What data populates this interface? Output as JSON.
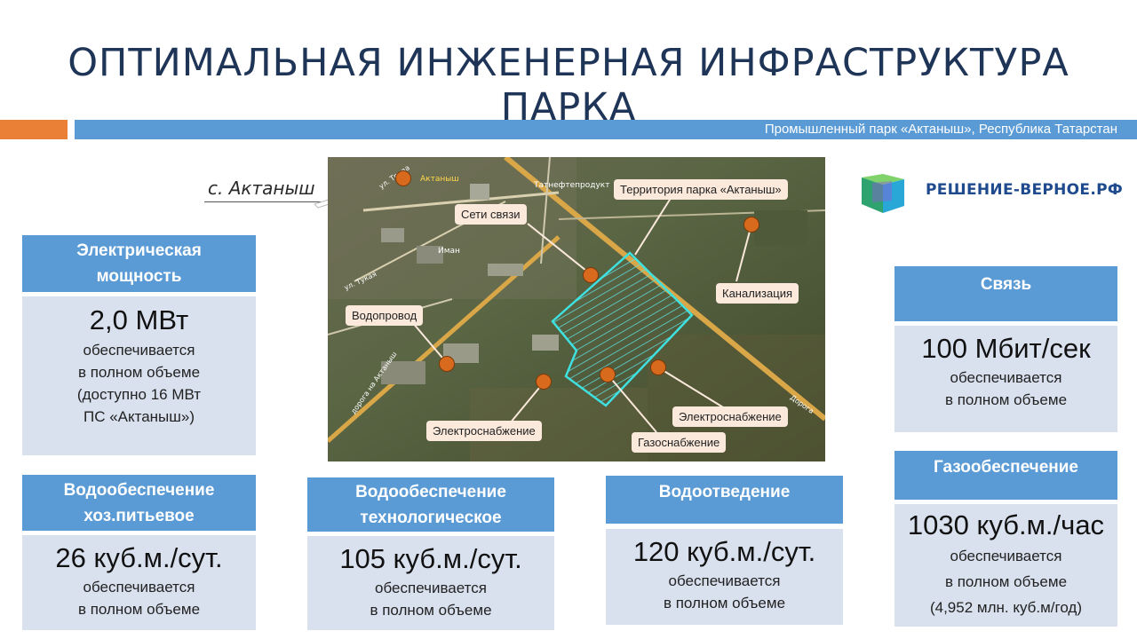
{
  "title": "ОПТИМАЛЬНАЯ ИНЖЕНЕРНАЯ ИНФРАСТРУКТУРА ПАРКА",
  "subtitle": "Промышленный парк «Актаныш», Республика Татарстан",
  "village_label": "с. Актаныш",
  "colors": {
    "accent_blue": "#5b9bd5",
    "accent_orange": "#ea7f36",
    "card_body": "#d9e1ef",
    "title": "#1f3558"
  },
  "logo": {
    "text": "РЕШЕНИЕ-ВЕРНОЕ.РФ",
    "icon": "cube-logo-icon"
  },
  "map": {
    "callouts": {
      "territory": "Территория парка «Актаныш»",
      "comms": "Сети связи",
      "sewer": "Канализация",
      "water": "Водопровод",
      "power_left": "Электроснабжение",
      "power_right": "Электроснабжение",
      "gas": "Газоснабжение"
    },
    "street_labels": {
      "top_village": "Актаныш",
      "bank": "Татнефтепродукт",
      "mosque": "Иман",
      "street_trud": "ул. Труда",
      "street_tukaya": "ул. Тукая",
      "road_left": "дорога на Актаныш",
      "road_right": "Дорога"
    }
  },
  "cards": {
    "electric": {
      "header_line1": "Электрическая",
      "header_line2": "мощность",
      "value": "2,0 МВт",
      "line1": "обеспечивается",
      "line2": "в полном объеме",
      "line3": "(доступно 16 МВт",
      "line4": "ПС «Актаныш»)"
    },
    "comms": {
      "header": "Связь",
      "value": "100 Мбит/сек",
      "line1": "обеспечивается",
      "line2": "в полном объеме"
    },
    "water_drink": {
      "header_line1": "Водообеспечение",
      "header_line2": "хоз.питьевое",
      "value": "26 куб.м./сут.",
      "line1": "обеспечивается",
      "line2": "в полном объеме"
    },
    "water_tech": {
      "header_line1": "Водообеспечение",
      "header_line2": "технологическое",
      "value": "105 куб.м./сут.",
      "line1": "обеспечивается",
      "line2": "в полном объеме"
    },
    "drainage": {
      "header": "Водоотведение",
      "value": "120 куб.м./сут.",
      "line1": "обеспечивается",
      "line2": "в полном объеме"
    },
    "gas": {
      "header": "Газообеспечение",
      "value": "1030 куб.м./час",
      "line1": "обеспечивается",
      "line2": "в полном объеме",
      "line3": "(4,952 млн. куб.м/год)"
    }
  }
}
